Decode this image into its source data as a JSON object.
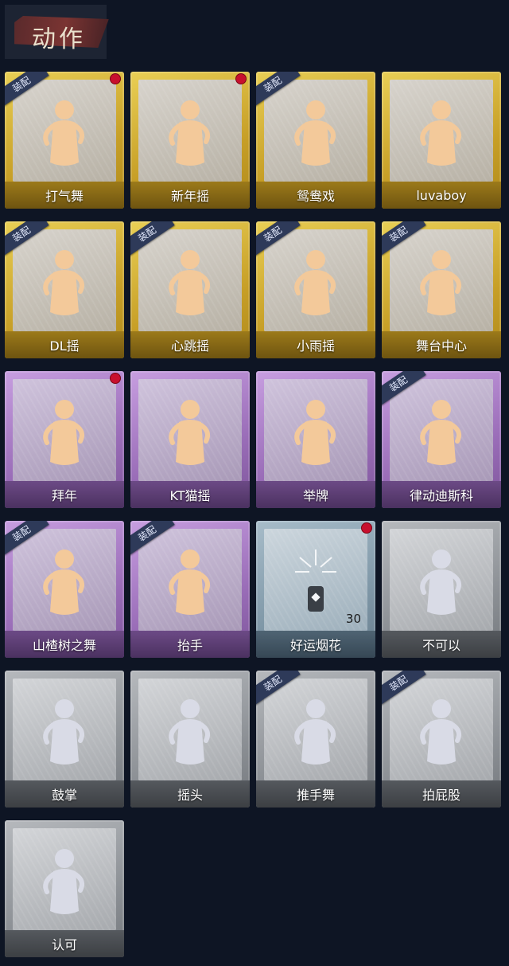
{
  "header": {
    "title": "动作"
  },
  "equip_label": "装配",
  "cards": [
    {
      "label": "打气舞",
      "tier": "gold",
      "equipped": true,
      "new": true
    },
    {
      "label": "新年摇",
      "tier": "gold",
      "equipped": false,
      "new": true
    },
    {
      "label": "鸳鸯戏",
      "tier": "gold",
      "equipped": true,
      "new": false
    },
    {
      "label": "luvaboy",
      "tier": "gold",
      "equipped": false,
      "new": false
    },
    {
      "label": "DL摇",
      "tier": "gold",
      "equipped": true,
      "new": false
    },
    {
      "label": "心跳摇",
      "tier": "gold",
      "equipped": true,
      "new": false
    },
    {
      "label": "小雨摇",
      "tier": "gold",
      "equipped": true,
      "new": false
    },
    {
      "label": "舞台中心",
      "tier": "gold",
      "equipped": true,
      "new": false
    },
    {
      "label": "拜年",
      "tier": "purple",
      "equipped": false,
      "new": true
    },
    {
      "label": "KT猫摇",
      "tier": "purple",
      "equipped": false,
      "new": false
    },
    {
      "label": "举牌",
      "tier": "purple",
      "equipped": false,
      "new": false
    },
    {
      "label": "律动迪斯科",
      "tier": "purple",
      "equipped": true,
      "new": false
    },
    {
      "label": "山楂树之舞",
      "tier": "purple",
      "equipped": true,
      "new": false
    },
    {
      "label": "抬手",
      "tier": "purple",
      "equipped": true,
      "new": false
    },
    {
      "label": "好运烟花",
      "tier": "blue",
      "equipped": false,
      "new": true,
      "count": "30"
    },
    {
      "label": "不可以",
      "tier": "grey",
      "equipped": false,
      "new": false
    },
    {
      "label": "鼓掌",
      "tier": "grey",
      "equipped": false,
      "new": false
    },
    {
      "label": "摇头",
      "tier": "grey",
      "equipped": false,
      "new": false
    },
    {
      "label": "推手舞",
      "tier": "grey",
      "equipped": true,
      "new": false
    },
    {
      "label": "拍屁股",
      "tier": "grey",
      "equipped": true,
      "new": false
    },
    {
      "label": "认可",
      "tier": "grey",
      "equipped": false,
      "new": false
    }
  ]
}
